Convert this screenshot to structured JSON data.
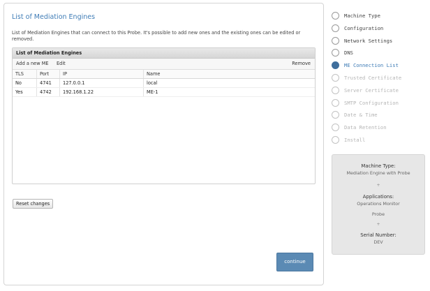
{
  "main": {
    "title": "List of Mediation Engines",
    "description": "List of Mediation Engines that can connect to this Probe. It's possible to add new ones and the existing ones can be edited or removed."
  },
  "table": {
    "title": "List of Mediation Engines",
    "toolbar": {
      "add": "Add a new ME",
      "edit": "Edit",
      "remove": "Remove"
    },
    "columns": [
      "TLS",
      "Port",
      "IP",
      "Name"
    ],
    "rows": [
      [
        "No",
        "4741",
        "127.0.0.1",
        "local"
      ],
      [
        "Yes",
        "4742",
        "192.168.1.22",
        "ME-1"
      ]
    ]
  },
  "buttons": {
    "reset": "Reset changes",
    "continue": "continue"
  },
  "steps": [
    {
      "label": "Machine Type",
      "state": "done"
    },
    {
      "label": "Configuration",
      "state": "done"
    },
    {
      "label": "Network Settings",
      "state": "done"
    },
    {
      "label": "DNS",
      "state": "done"
    },
    {
      "label": "ME Connection List",
      "state": "active"
    },
    {
      "label": "Trusted Certificate",
      "state": "disabled"
    },
    {
      "label": "Server Certificate",
      "state": "disabled"
    },
    {
      "label": "SMTP Configuration",
      "state": "disabled"
    },
    {
      "label": "Date & Time",
      "state": "disabled"
    },
    {
      "label": "Data Retention",
      "state": "disabled"
    },
    {
      "label": "Install",
      "state": "disabled"
    }
  ],
  "info": {
    "machine_type_label": "Machine Type:",
    "machine_type_value": "Mediation Engine with Probe",
    "applications_label": "Applications:",
    "applications": [
      "Operations Monitor",
      "Probe"
    ],
    "plus": "+",
    "serial_label": "Serial Number:",
    "serial_value": "DEV"
  },
  "colors": {
    "accent": "#3f7cb6",
    "continue_button": "#5b8ab4",
    "active_step": "#3f6e9c"
  }
}
